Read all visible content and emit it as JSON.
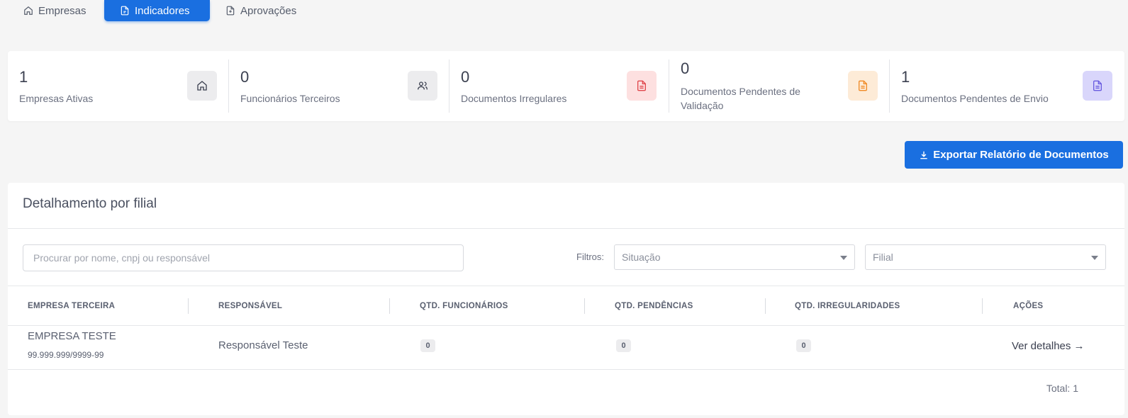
{
  "tabs": [
    {
      "label": "Empresas",
      "icon": "home-icon"
    },
    {
      "label": "Indicadores",
      "icon": "document-icon"
    },
    {
      "label": "Aprovações",
      "icon": "document-plus-icon"
    }
  ],
  "stats": [
    {
      "value": "1",
      "label": "Empresas Ativas",
      "icon": "building-icon",
      "icon_bg": "#ececee",
      "icon_color": "#3b4050"
    },
    {
      "value": "0",
      "label": "Funcionários Terceiros",
      "icon": "users-icon",
      "icon_bg": "#ececee",
      "icon_color": "#3b4050"
    },
    {
      "value": "0",
      "label": "Documentos Irregulares",
      "icon": "document-icon",
      "icon_bg": "#fde0e0",
      "icon_color": "#e0474c"
    },
    {
      "value": "0",
      "label_line1": "Documentos Pendentes de",
      "label_line2": "Validação",
      "icon": "document-icon",
      "icon_bg": "#fdebd7",
      "icon_color": "#f08a24"
    },
    {
      "value": "1",
      "label": "Documentos Pendentes de Envio",
      "icon": "document-icon",
      "icon_bg": "#d9d6fb",
      "icon_color": "#6a5ce0"
    }
  ],
  "export_button": "Exportar Relatório de Documentos",
  "panel": {
    "title": "Detalhamento por filial",
    "search_placeholder": "Procurar por nome, cnpj ou responsável",
    "filters_label": "Filtros:",
    "filter_situacao": "Situação",
    "filter_filial": "Filial"
  },
  "table": {
    "columns": [
      "EMPRESA TERCEIRA",
      "RESPONSÁVEL",
      "QTD. FUNCIONÁRIOS",
      "QTD. PENDÊNCIAS",
      "QTD. IRREGULARIDADES",
      "AÇÕES"
    ],
    "rows": [
      {
        "empresa": "EMPRESA TESTE",
        "cnpj": "99.999.999/9999-99",
        "responsavel": "Responsável Teste",
        "funcionarios": "0",
        "pendencias": "0",
        "irregularidades": "0",
        "acao": "Ver detalhes →"
      }
    ],
    "total": "Total: 1"
  },
  "colors": {
    "primary": "#1a6fe0",
    "background": "#f5f5f5"
  }
}
